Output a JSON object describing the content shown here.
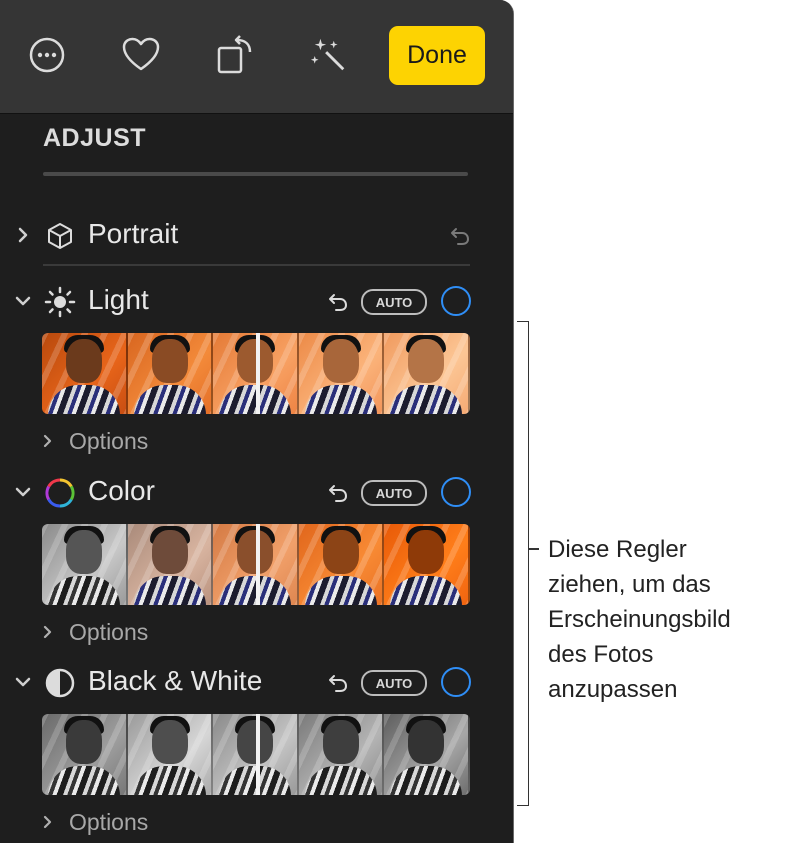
{
  "toolbar": {
    "icons": [
      "more-icon",
      "heart-icon",
      "rotate-icon",
      "magic-wand-icon"
    ],
    "done_label": "Done",
    "accent": "#fdd302"
  },
  "adjust": {
    "title": "ADJUST",
    "sections": [
      {
        "label": "Portrait",
        "expanded": false,
        "icon": "cube-icon"
      },
      {
        "label": "Light",
        "expanded": true,
        "icon": "sun-icon",
        "auto_label": "AUTO",
        "options_label": "Options"
      },
      {
        "label": "Color",
        "expanded": true,
        "icon": "color-wheel-icon",
        "auto_label": "AUTO",
        "options_label": "Options"
      },
      {
        "label": "Black & White",
        "expanded": true,
        "icon": "half-circle-icon",
        "auto_label": "AUTO",
        "options_label": "Options"
      }
    ]
  },
  "callout": {
    "lines": [
      "Diese Regler",
      "ziehen, um das",
      "Erscheinungsbild",
      "des Fotos",
      "anzupassen"
    ]
  },
  "colors": {
    "panel_bg": "#1e1e1e",
    "toolbar_bg": "#353535",
    "toggle": "#2f8ef6"
  }
}
